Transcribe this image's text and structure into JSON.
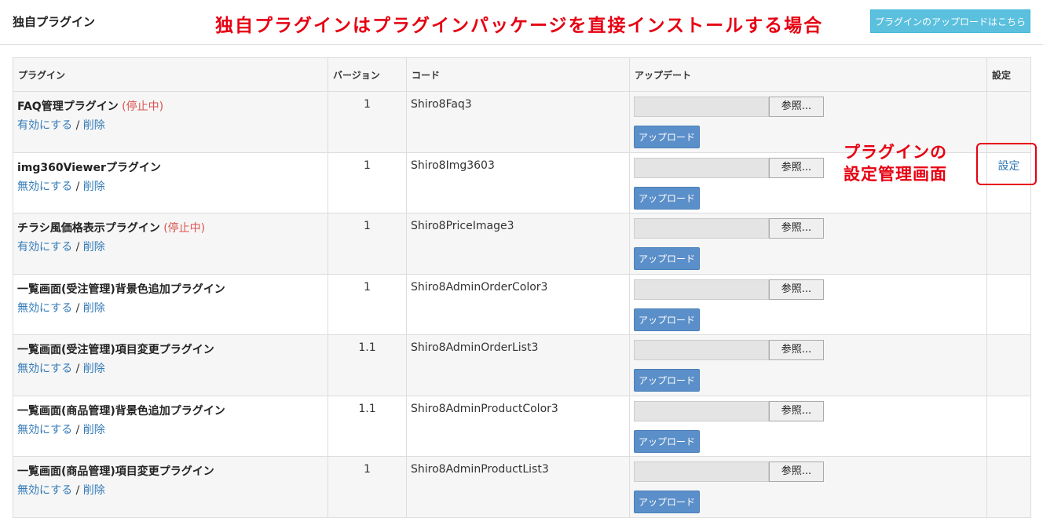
{
  "header": {
    "title": "独自プラグイン",
    "annotation": "独自プラグインはプラグインパッケージを直接インストールする場合",
    "upload_link_label": "プラグインのアップロードはこちら"
  },
  "table": {
    "columns": [
      "プラグイン",
      "バージョン",
      "コード",
      "アップデート",
      "設定"
    ],
    "browse_label": "参照...",
    "upload_label": "アップロード",
    "separator": " / ",
    "rows": [
      {
        "name": "FAQ管理プラグイン",
        "status": "(停止中)",
        "toggle": "有効にする",
        "delete": "削除",
        "version": "1",
        "code": "Shiro8Faq3",
        "settings": ""
      },
      {
        "name": "img360Viewerプラグイン",
        "status": "",
        "toggle": "無効にする",
        "delete": "削除",
        "version": "1",
        "code": "Shiro8Img3603",
        "settings": "設定"
      },
      {
        "name": "チラシ風価格表示プラグイン",
        "status": "(停止中)",
        "toggle": "有効にする",
        "delete": "削除",
        "version": "1",
        "code": "Shiro8PriceImage3",
        "settings": ""
      },
      {
        "name": "一覧画面(受注管理)背景色追加プラグイン",
        "status": "",
        "toggle": "無効にする",
        "delete": "削除",
        "version": "1",
        "code": "Shiro8AdminOrderColor3",
        "settings": ""
      },
      {
        "name": "一覧画面(受注管理)項目変更プラグイン",
        "status": "",
        "toggle": "無効にする",
        "delete": "削除",
        "version": "1.1",
        "code": "Shiro8AdminOrderList3",
        "settings": ""
      },
      {
        "name": "一覧画面(商品管理)背景色追加プラグイン",
        "status": "",
        "toggle": "無効にする",
        "delete": "削除",
        "version": "1.1",
        "code": "Shiro8AdminProductColor3",
        "settings": ""
      },
      {
        "name": "一覧画面(商品管理)項目変更プラグイン",
        "status": "",
        "toggle": "無効にする",
        "delete": "削除",
        "version": "1",
        "code": "Shiro8AdminProductList3",
        "settings": ""
      }
    ]
  },
  "settings_annotation": {
    "line1": "プラグインの",
    "line2": "設定管理画面"
  },
  "colors": {
    "annotation_red": "#e60012",
    "link_blue": "#337ab7",
    "stopped_red": "#d9534f",
    "upload_button": "#5b8fc9",
    "upload_link_button": "#5bc0de"
  }
}
